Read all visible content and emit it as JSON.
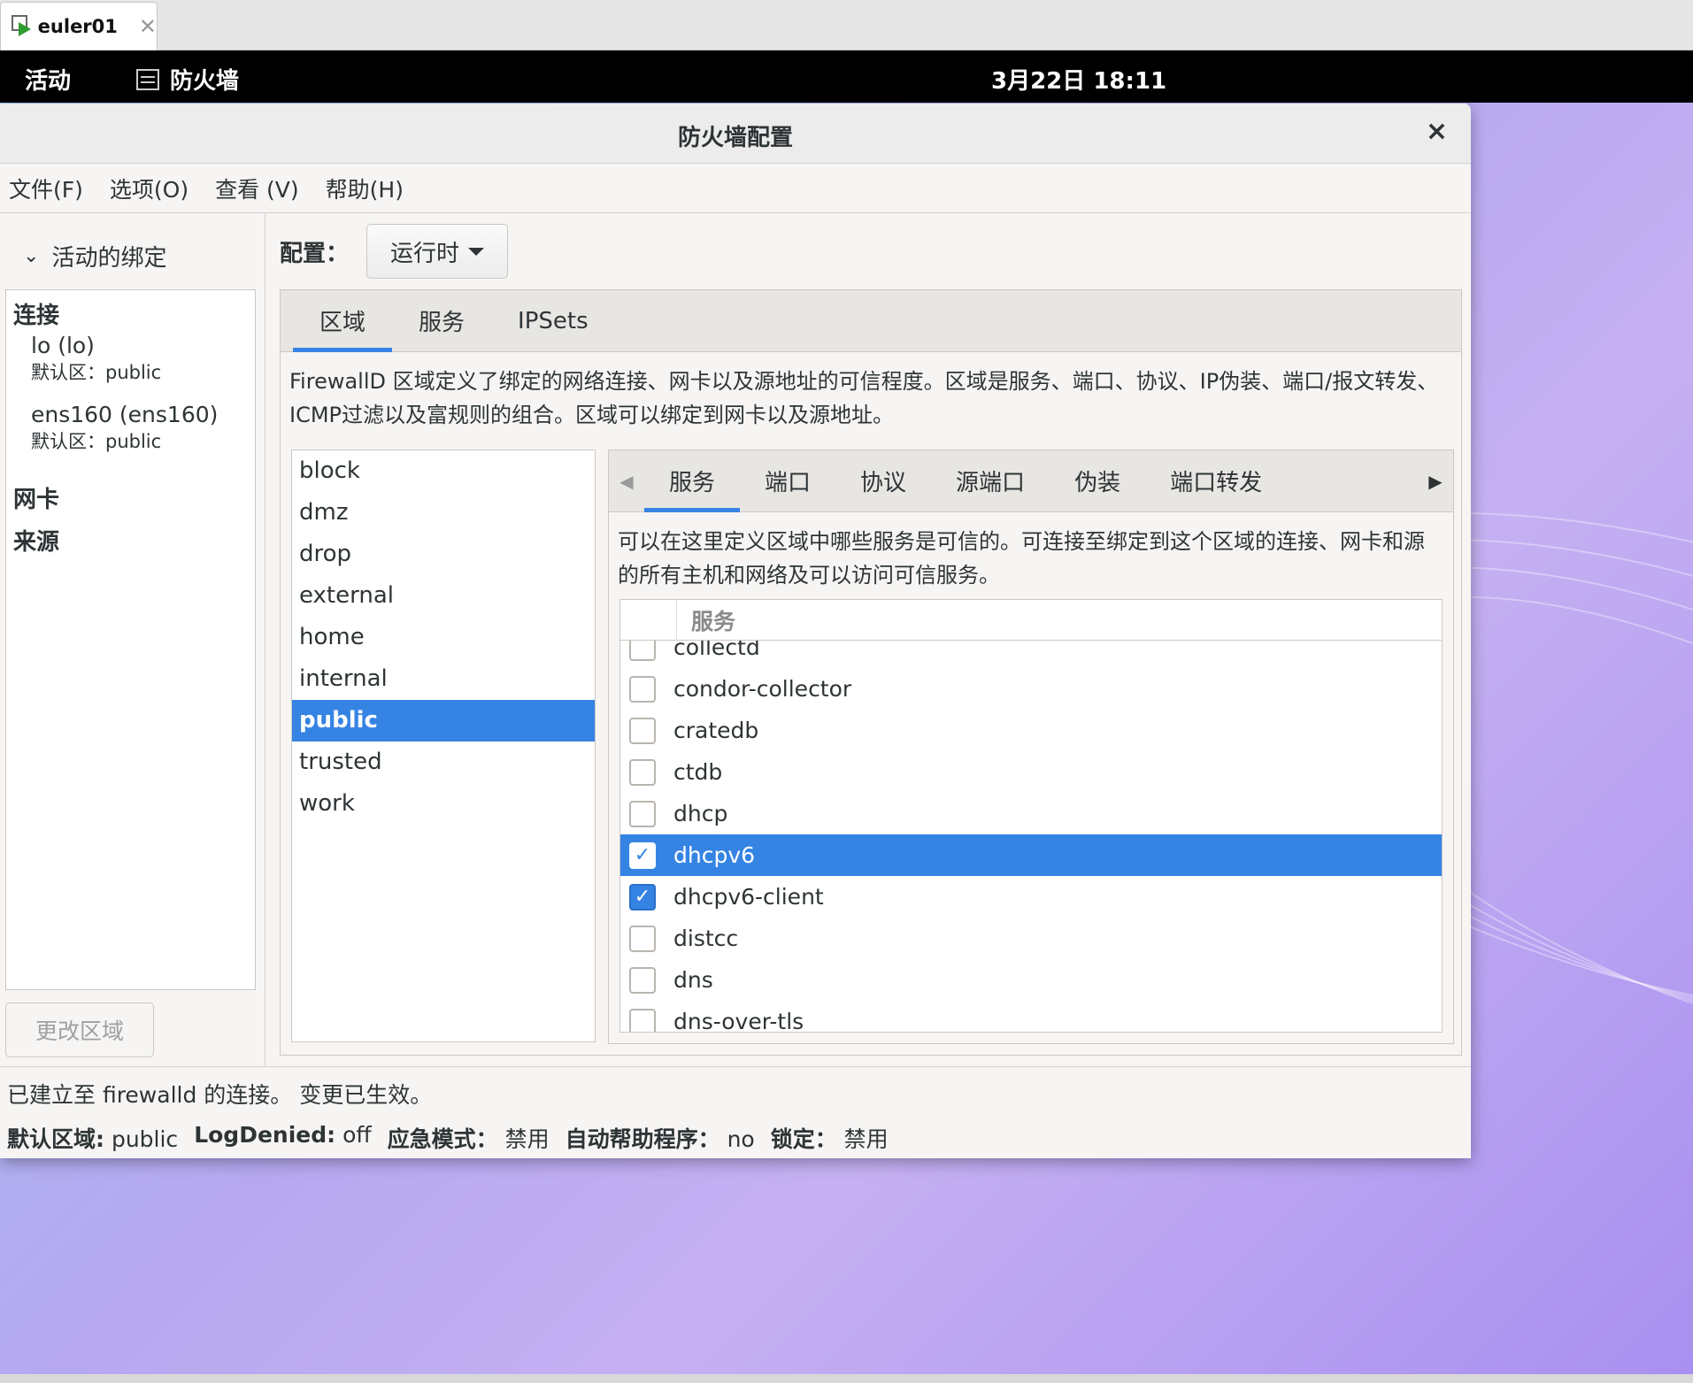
{
  "vm_tab": {
    "name": "euler01",
    "close": "✕"
  },
  "topbar": {
    "activities": "活动",
    "app_name": "防火墙",
    "clock": "3月22日  18:11"
  },
  "window": {
    "title": "防火墙配置",
    "close": "×",
    "menu": [
      "文件(F)",
      "选项(O)",
      "查看 (V)",
      "帮助(H)"
    ]
  },
  "sidebar": {
    "expander_label": "活动的绑定",
    "connections_heading": "连接",
    "connections": [
      {
        "name": "lo (lo)",
        "zone": "默认区：public"
      },
      {
        "name": "ens160 (ens160)",
        "zone": "默认区：public"
      }
    ],
    "interfaces_heading": "网卡",
    "sources_heading": "来源",
    "change_zone_button": "更改区域"
  },
  "config": {
    "label": "配置：",
    "value": "运行时"
  },
  "main_tabs": [
    "区域",
    "服务",
    "IPSets"
  ],
  "zone_description": "FirewallD 区域定义了绑定的网络连接、网卡以及源地址的可信程度。区域是服务、端口、协议、IP伪装、端口/报文转发、ICMP过滤以及富规则的组合。区域可以绑定到网卡以及源地址。",
  "zones": [
    "block",
    "dmz",
    "drop",
    "external",
    "home",
    "internal",
    "public",
    "trusted",
    "work"
  ],
  "selected_zone": "public",
  "zone_sub_tabs": [
    "服务",
    "端口",
    "协议",
    "源端口",
    "伪装",
    "端口转发"
  ],
  "services_description": "可以在这里定义区域中哪些服务是可信的。可连接至绑定到这个区域的连接、网卡和源的所有主机和网络及可以访问可信服务。",
  "services_column_header": "服务",
  "services": [
    {
      "name": "collectd",
      "checked": false
    },
    {
      "name": "condor-collector",
      "checked": false
    },
    {
      "name": "cratedb",
      "checked": false
    },
    {
      "name": "ctdb",
      "checked": false
    },
    {
      "name": "dhcp",
      "checked": false
    },
    {
      "name": "dhcpv6",
      "checked": true,
      "selected": true
    },
    {
      "name": "dhcpv6-client",
      "checked": true
    },
    {
      "name": "distcc",
      "checked": false
    },
    {
      "name": "dns",
      "checked": false
    },
    {
      "name": "dns-over-tls",
      "checked": false
    }
  ],
  "status": {
    "line1": "已建立至 firewalld 的连接。  变更已生效。",
    "default_zone_key": "默认区域:",
    "default_zone_val": "public",
    "logdenied_key": "LogDenied:",
    "logdenied_val": "off",
    "panic_key": "应急模式：",
    "panic_val": "禁用",
    "helpers_key": "自动帮助程序：",
    "helpers_val": "no",
    "lockdown_key": "锁定：",
    "lockdown_val": "禁用"
  },
  "colors": {
    "accent": "#3584e4",
    "topbar": "#000000"
  }
}
